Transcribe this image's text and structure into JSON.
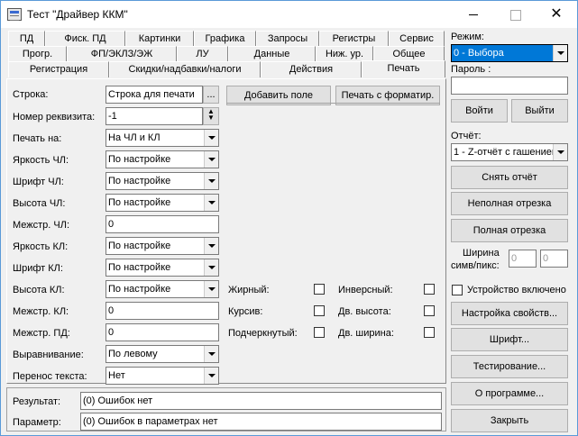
{
  "window": {
    "title": "Тест \"Драйвер ККМ\""
  },
  "tabs": {
    "row1": [
      "ПД",
      "Фиск. ПД",
      "Картинки",
      "Графика",
      "Запросы",
      "Регистры",
      "Сервис"
    ],
    "row2": [
      "Прогр.",
      "ФП/ЭКЛЗ/ЭЖ",
      "ЛУ",
      "Данные",
      "Ниж. ур.",
      "Общее"
    ],
    "row3": [
      "Регистрация",
      "Скидки/надбавки/налоги",
      "Действия",
      "Печать"
    ]
  },
  "form": {
    "line_label": "Строка:",
    "line_value": "Строка для печати",
    "ellipsis": "...",
    "req_label": "Номер реквизита:",
    "req_value": "-1",
    "print_on_label": "Печать на:",
    "print_on_value": "На ЧЛ и КЛ",
    "bright_cl_label": "Яркость ЧЛ:",
    "bright_cl_value": "По настройке",
    "font_cl_label": "Шрифт ЧЛ:",
    "font_cl_value": "По настройке",
    "height_cl_label": "Высота ЧЛ:",
    "height_cl_value": "По настройке",
    "spacing_cl_label": "Межстр. ЧЛ:",
    "spacing_cl_value": "0",
    "bright_kl_label": "Яркость КЛ:",
    "bright_kl_value": "По настройке",
    "font_kl_label": "Шрифт КЛ:",
    "font_kl_value": "По настройке",
    "height_kl_label": "Высота КЛ:",
    "height_kl_value": "По настройке",
    "spacing_kl_label": "Межстр. КЛ:",
    "spacing_kl_value": "0",
    "spacing_pd_label": "Межстр. ПД:",
    "spacing_pd_value": "0",
    "align_label": "Выравнивание:",
    "align_value": "По левому",
    "wrap_label": "Перенос текста:",
    "wrap_value": "Нет",
    "add_field": "Добавить поле",
    "print_format": "Печать с форматир.",
    "bold": "Жирный:",
    "italic": "Курсив:",
    "underline": "Подчеркнутый:",
    "inverse": "Инверсный:",
    "dbl_height": "Дв. высота:",
    "dbl_width": "Дв. ширина:"
  },
  "status": {
    "result_label": "Результат:",
    "result_value": "(0) Ошибок нет",
    "param_label": "Параметр:",
    "param_value": "(0) Ошибок в параметрах нет"
  },
  "right": {
    "mode_label": "Режим:",
    "mode_value": "0 - Выбора",
    "password_label": "Пароль :",
    "password_value": "",
    "login": "Войти",
    "logout": "Выйти",
    "report_label": "Отчёт:",
    "report_value": "1 - Z-отчёт с гашением",
    "take_report": "Снять отчёт",
    "partial_cut": "Неполная отрезка",
    "full_cut": "Полная отрезка",
    "width_label_1": "Ширина",
    "width_label_2": "симв/пикс:",
    "width_val1": "0",
    "width_val2": "0",
    "device_on": "Устройство включено",
    "properties": "Настройка свойств...",
    "font": "Шрифт...",
    "testing": "Тестирование...",
    "about": "О программе...",
    "close": "Закрыть"
  },
  "colors": {
    "selection": "#0078d7",
    "window_bg": "#f0f0f0"
  }
}
